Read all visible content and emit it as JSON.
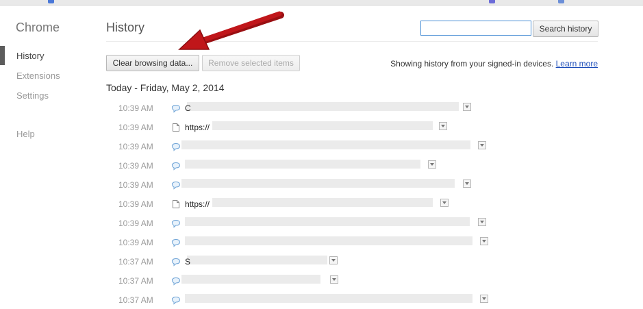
{
  "sidebar": {
    "brand": "Chrome",
    "items": [
      {
        "label": "History",
        "active": true
      },
      {
        "label": "Extensions"
      },
      {
        "label": "Settings"
      },
      {
        "label": "Help"
      }
    ]
  },
  "header": {
    "title": "History",
    "search_value": "",
    "search_button": "Search history"
  },
  "toolbar": {
    "clear_label": "Clear browsing data...",
    "remove_label": "Remove selected items"
  },
  "info": {
    "text": "Showing history from your signed-in devices.",
    "link": "Learn more"
  },
  "date_heading": "Today - Friday, May 2, 2014",
  "entries": [
    {
      "time": "10:39 AM",
      "icon": "cloud-icon",
      "text": "C"
    },
    {
      "time": "10:39 AM",
      "icon": "page-icon",
      "text": "https://"
    },
    {
      "time": "10:39 AM",
      "icon": "cloud-icon",
      "text": ""
    },
    {
      "time": "10:39 AM",
      "icon": "cloud-icon",
      "text": ""
    },
    {
      "time": "10:39 AM",
      "icon": "cloud-icon",
      "text": ""
    },
    {
      "time": "10:39 AM",
      "icon": "page-icon",
      "text": "https://"
    },
    {
      "time": "10:39 AM",
      "icon": "cloud-icon",
      "text": ""
    },
    {
      "time": "10:39 AM",
      "icon": "cloud-icon",
      "text": ""
    },
    {
      "time": "10:37 AM",
      "icon": "cloud-icon",
      "text": "S"
    },
    {
      "time": "10:37 AM",
      "icon": "cloud-icon",
      "text": ""
    },
    {
      "time": "10:37 AM",
      "icon": "cloud-icon",
      "text": ""
    }
  ],
  "colors": {
    "accent_link": "#1a4bb8",
    "search_focus": "#4a8fd4",
    "arrow": "#c0161a"
  }
}
